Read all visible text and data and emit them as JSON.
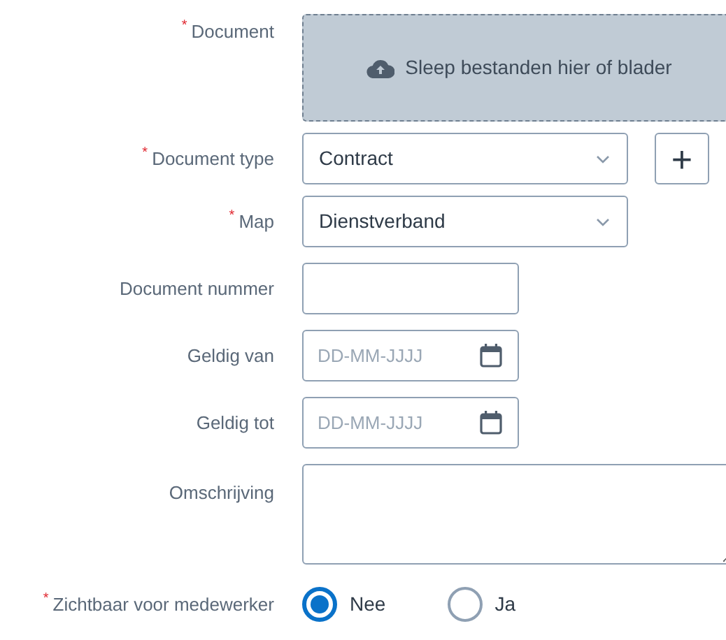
{
  "required_mark": "*",
  "fields": [
    {
      "kind": "upload",
      "label": "Document",
      "required": true,
      "text": "Sleep bestanden hier of blader"
    },
    {
      "kind": "select",
      "label": "Document type",
      "required": true,
      "value": "Contract",
      "add_button": "+"
    },
    {
      "kind": "select",
      "label": "Map",
      "required": true,
      "value": "Dienstverband"
    },
    {
      "kind": "text",
      "label": "Document nummer",
      "required": false
    },
    {
      "kind": "date",
      "label": "Geldig van",
      "required": false,
      "placeholder": "DD-MM-JJJJ"
    },
    {
      "kind": "date",
      "label": "Geldig tot",
      "required": false,
      "placeholder": "DD-MM-JJJJ"
    },
    {
      "kind": "textarea",
      "label": "Omschrijving",
      "required": false
    },
    {
      "kind": "radio",
      "label": "Zichtbaar voor medewerker",
      "required": true,
      "options": [
        {
          "label": "Nee",
          "selected": true
        },
        {
          "label": "Ja",
          "selected": false
        }
      ]
    }
  ]
}
